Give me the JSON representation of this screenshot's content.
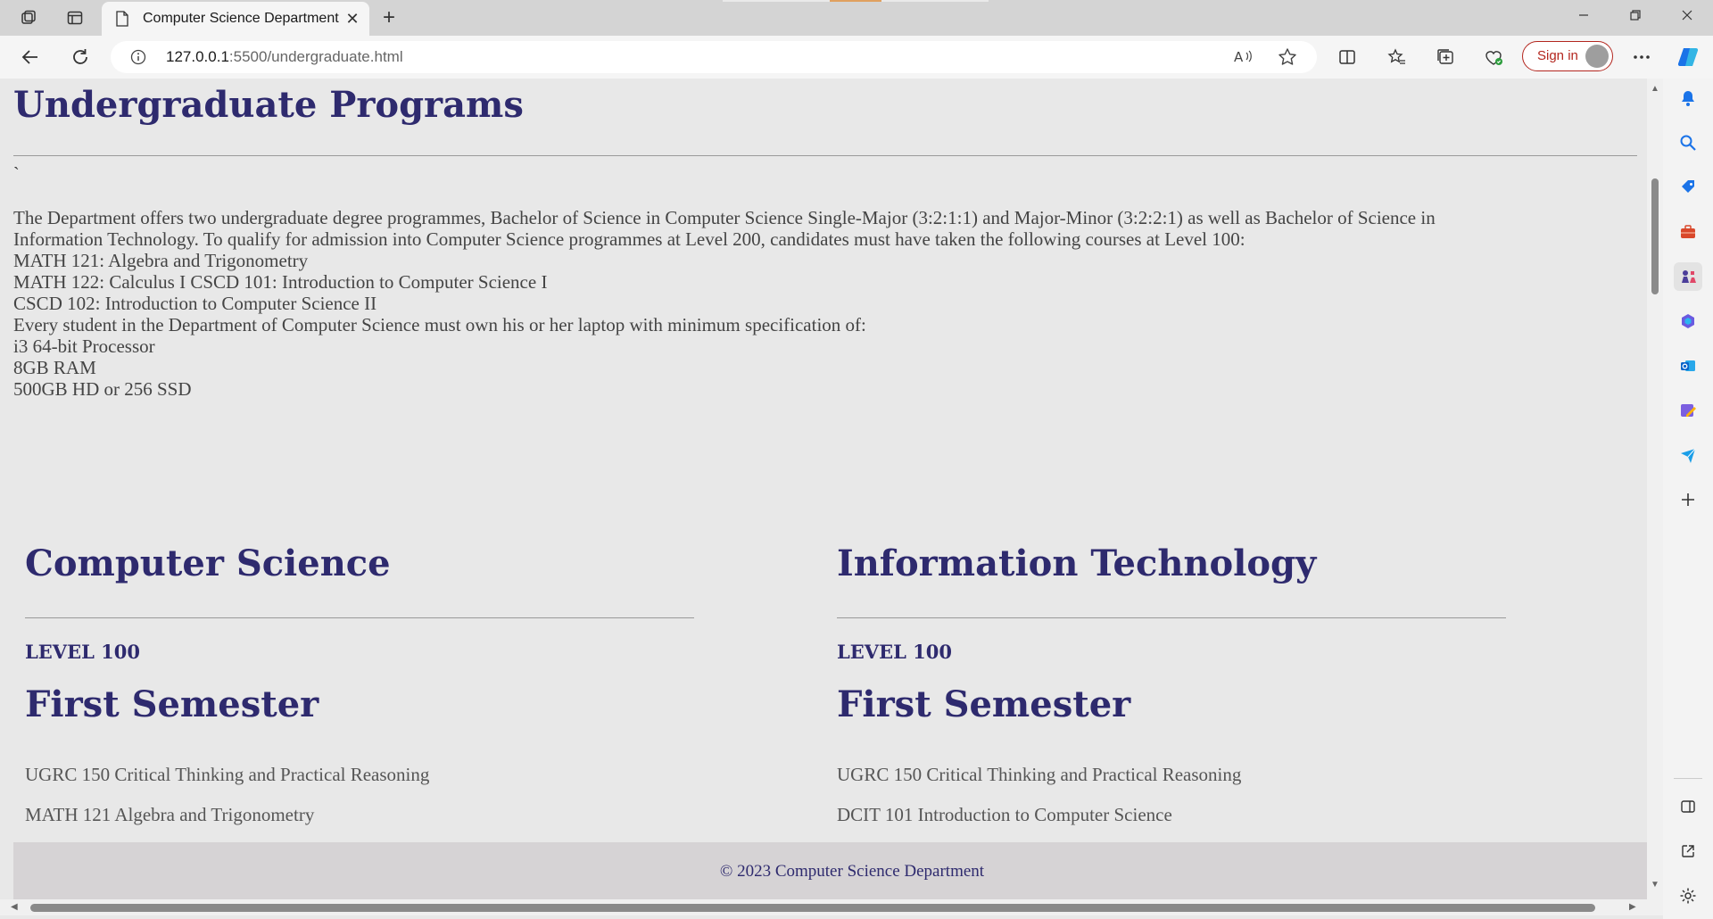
{
  "browser": {
    "tab_title": "Computer Science Department",
    "url_host": "127.0.0.1",
    "url_path": ":5500/undergraduate.html",
    "signin_label": "Sign in",
    "new_tab_glyph": "+",
    "tab_close_glyph": "✕",
    "icons": [
      "workspaces-icon",
      "tab-actions-icon",
      "back-icon",
      "refresh-icon",
      "info-icon",
      "read-aloud-icon",
      "favorite-star-icon",
      "split-screen-icon",
      "favorites-icon",
      "collections-icon",
      "browser-essentials-icon",
      "more-icon",
      "copilot-icon"
    ]
  },
  "page": {
    "title": "Undergraduate Programs",
    "backtick": "`",
    "intro_lines": [
      "The Department offers two undergraduate degree programmes, Bachelor of Science in Computer Science Single-Major (3:2:1:1) and Major-Minor (3:2:2:1) as well as Bachelor of Science in",
      "Information Technology. To qualify for admission into Computer Science programmes at Level 200, candidates must have taken the following courses at Level 100:",
      "MATH 121: Algebra and Trigonometry",
      "MATH 122: Calculus I CSCD 101: Introduction to Computer Science I",
      "CSCD 102: Introduction to Computer Science II",
      "Every student in the Department of Computer Science must own his or her laptop with minimum specification of:",
      "i3 64-bit Processor",
      "8GB RAM",
      "500GB HD or 256 SSD"
    ],
    "columns": [
      {
        "heading": "Computer Science",
        "level": "LEVEL 100",
        "semester": "First Semester",
        "courses": [
          "UGRC 150 Critical Thinking and Practical Reasoning",
          "MATH 121 Algebra and Trigonometry"
        ]
      },
      {
        "heading": "Information Technology",
        "level": "LEVEL 100",
        "semester": "First Semester",
        "courses": [
          "UGRC 150 Critical Thinking and Practical Reasoning",
          "DCIT 101 Introduction to Computer Science"
        ]
      }
    ],
    "footer": "© 2023 Computer Science Department"
  },
  "sidebar": {
    "icons": [
      "notifications-icon",
      "search-icon",
      "shopping-icon",
      "tools-icon",
      "games-icon",
      "microsoft365-icon",
      "outlook-icon",
      "designer-icon",
      "send-icon",
      "add-icon",
      "sidebar-toggle-icon",
      "external-link-icon",
      "settings-icon"
    ]
  },
  "colors": {
    "heading": "#2e2a6e",
    "page_bg": "#e8e8e8",
    "footer_bg": "#d6d3d5",
    "signin_accent": "#b3261e",
    "copilot": "#1a73e8"
  }
}
